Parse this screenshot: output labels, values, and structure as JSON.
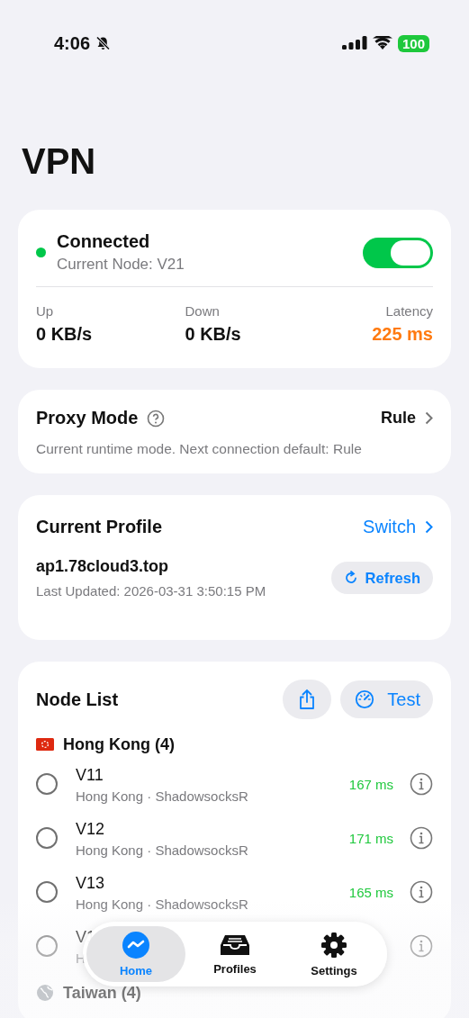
{
  "status_bar": {
    "time": "4:06",
    "battery": "100"
  },
  "title": "VPN",
  "connection": {
    "status": "Connected",
    "node": "Current Node: V21",
    "on": true,
    "stats": [
      {
        "label": "Up",
        "value": "0 KB/s",
        "highlight": false
      },
      {
        "label": "Down",
        "value": "0 KB/s",
        "highlight": false
      },
      {
        "label": "Latency",
        "value": "225 ms",
        "highlight": true
      }
    ]
  },
  "proxy_mode": {
    "title": "Proxy Mode",
    "value": "Rule",
    "description": "Current runtime mode. Next connection default: Rule"
  },
  "profile": {
    "title": "Current Profile",
    "switch_label": "Switch",
    "name": "ap1.78cloud3.top",
    "updated": "Last Updated: 2026-03-31 3:50:15 PM",
    "refresh_label": "Refresh"
  },
  "node_list": {
    "title": "Node List",
    "test_label": "Test",
    "groups": [
      {
        "kind": "flag",
        "name": "Hong Kong (4)",
        "nodes": [
          {
            "name": "V11",
            "detail": "Hong Kong · ShadowsocksR",
            "latency": "167 ms",
            "selected": false
          },
          {
            "name": "V12",
            "detail": "Hong Kong · ShadowsocksR",
            "latency": "171 ms",
            "selected": false
          },
          {
            "name": "V13",
            "detail": "Hong Kong · ShadowsocksR",
            "latency": "165 ms",
            "selected": false
          },
          {
            "name": "V1",
            "detail": "H",
            "selected": false
          }
        ]
      },
      {
        "kind": "globe",
        "name": "Taiwan (4)"
      }
    ]
  },
  "tab_bar": {
    "items": [
      {
        "kind": "home",
        "label": "Home",
        "selected": true
      },
      {
        "kind": "profiles",
        "label": "Profiles",
        "selected": false
      },
      {
        "kind": "settings",
        "label": "Settings",
        "selected": false
      }
    ]
  }
}
